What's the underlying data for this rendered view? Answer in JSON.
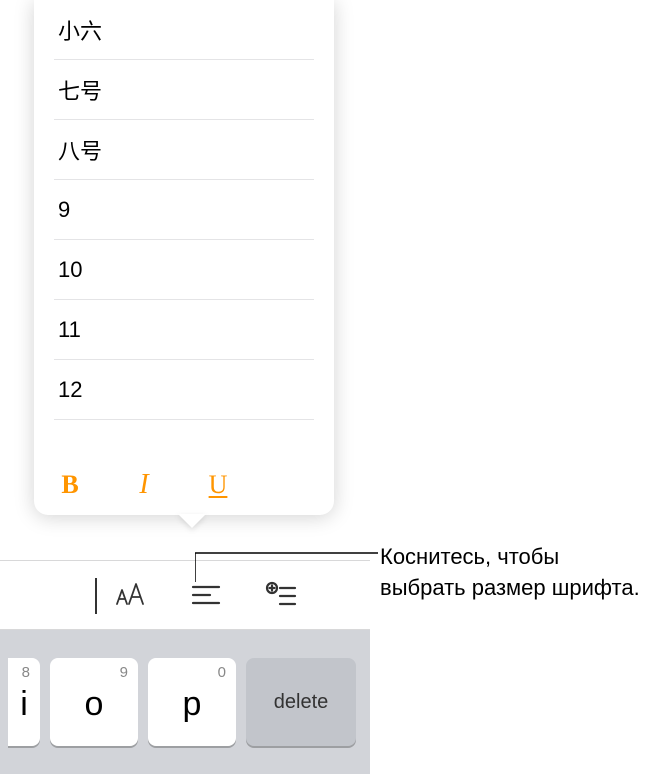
{
  "sizes": [
    "小六",
    "七号",
    "八号",
    "9",
    "10",
    "11",
    "12"
  ],
  "format": {
    "bold": "B",
    "italic": "I",
    "underline": "U"
  },
  "keyboard": {
    "keys": [
      {
        "hint": "8",
        "main": "i",
        "partial": true
      },
      {
        "hint": "9",
        "main": "o"
      },
      {
        "hint": "0",
        "main": "p"
      }
    ],
    "delete": "delete"
  },
  "callout": "Коснитесь, чтобы выбрать размер шрифта."
}
